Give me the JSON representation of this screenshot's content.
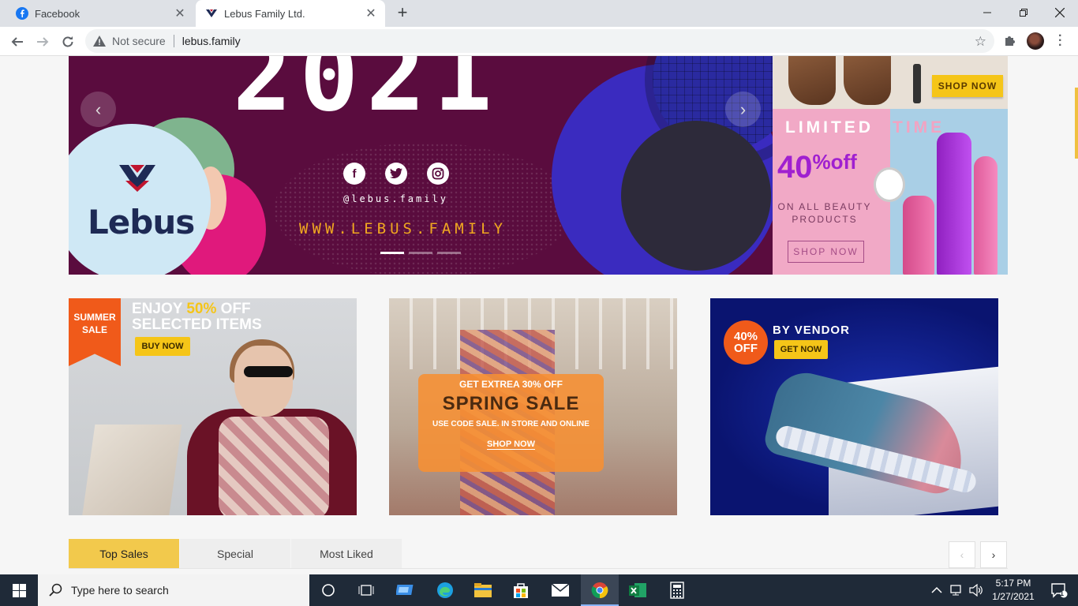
{
  "browser": {
    "tabs": [
      {
        "title": "Facebook",
        "active": false
      },
      {
        "title": "Lebus Family Ltd.",
        "active": true
      }
    ],
    "address": {
      "security_label": "Not secure",
      "url": "lebus.family"
    }
  },
  "hero": {
    "year": "2021",
    "handle": "@lebus.family",
    "website": "WWW.LEBUS.FAMILY",
    "brand": "Lebus",
    "slide_count": 3,
    "active_slide": 1
  },
  "side_banner_top": {
    "cta": "SHOP NOW"
  },
  "side_banner_bottom": {
    "headline_1": "LIMITED",
    "headline_2": "TIME",
    "percent": "40",
    "percent_suffix": "%off",
    "subtitle": "ON ALL BEAUTY PRODUCTS",
    "cta": "SHOP NOW"
  },
  "promos": [
    {
      "ribbon": "SUMMER SALE",
      "line1_a": "ENJOY ",
      "line1_b": "50%",
      "line1_c": " OFF",
      "line2": "SELECTED ITEMS",
      "cta": "BUY NOW"
    },
    {
      "kicker": "GET EXTREA 30% OFF",
      "title": "SPRING SALE",
      "note": "USE CODE SALE. IN STORE AND ONLINE",
      "cta": "SHOP NOW"
    },
    {
      "badge": "40% OFF",
      "title": "BY VENDOR",
      "cta": "GET NOW"
    }
  ],
  "product_tabs": [
    {
      "label": "Top Sales",
      "active": true
    },
    {
      "label": "Special",
      "active": false
    },
    {
      "label": "Most Liked",
      "active": false
    }
  ],
  "taskbar": {
    "search_placeholder": "Type here to search",
    "time": "5:17 PM",
    "date": "1/27/2021",
    "notification_count": "1"
  },
  "colors": {
    "accent_yellow": "#f2c94c",
    "hero_purple": "#5a0c3e",
    "taskbar": "#1f2a38"
  }
}
